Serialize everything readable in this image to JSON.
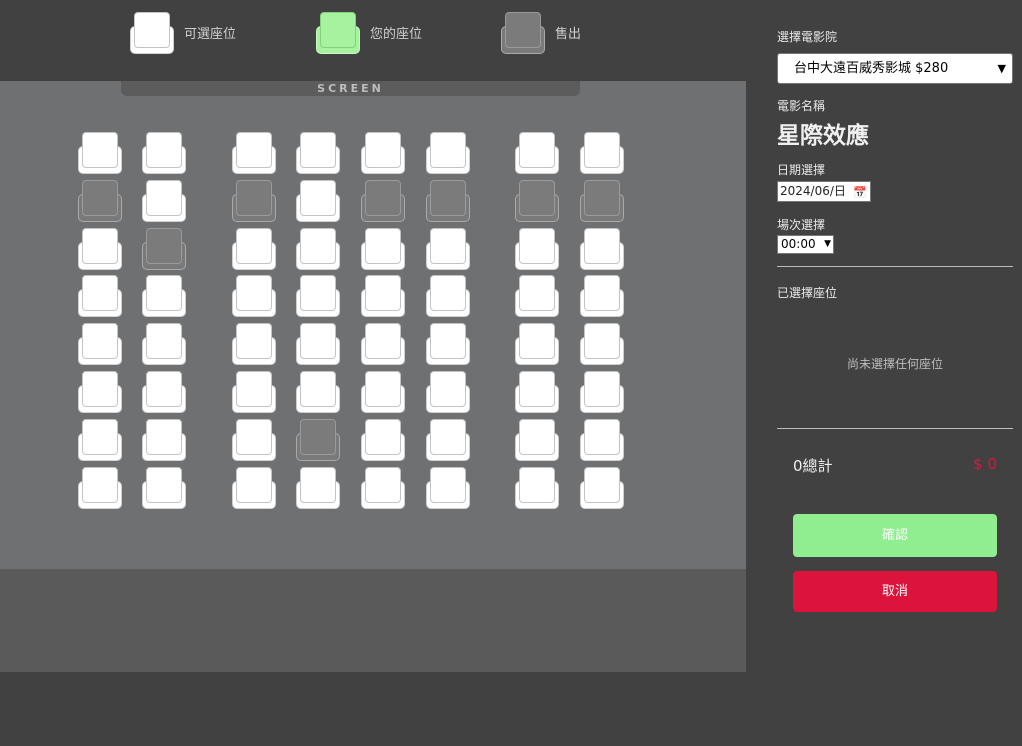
{
  "legend": {
    "available_label": "可選座位",
    "mine_label": "您的座位",
    "sold_label": "售出"
  },
  "screen_label": "SCREEN",
  "seats": [
    [
      "available",
      "available",
      "available",
      "available",
      "available",
      "available",
      "available",
      "available"
    ],
    [
      "sold",
      "available",
      "sold",
      "available",
      "sold",
      "sold",
      "sold",
      "sold"
    ],
    [
      "available",
      "sold",
      "available",
      "available",
      "available",
      "available",
      "available",
      "available"
    ],
    [
      "available",
      "available",
      "available",
      "available",
      "available",
      "available",
      "available",
      "available"
    ],
    [
      "available",
      "available",
      "available",
      "available",
      "available",
      "available",
      "available",
      "available"
    ],
    [
      "available",
      "available",
      "available",
      "available",
      "available",
      "available",
      "available",
      "available"
    ],
    [
      "available",
      "available",
      "available",
      "sold",
      "available",
      "available",
      "available",
      "available"
    ],
    [
      "available",
      "available",
      "available",
      "available",
      "available",
      "available",
      "available",
      "available"
    ]
  ],
  "panel": {
    "cinema_label": "選擇電影院",
    "cinema_value": "台中大遠百威秀影城 $280",
    "movie_label": "電影名稱",
    "movie_title": "星際效應",
    "date_label": "日期選擇",
    "date_value": "2024/06/日",
    "time_label": "場次選擇",
    "time_value": "00:00",
    "selected_label": "已選擇座位",
    "empty_message": "尚未選擇任何座位",
    "total_label": "0總計",
    "total_price": "$ 0",
    "confirm_label": "確認",
    "cancel_label": "取消"
  },
  "colors": {
    "available": "#ffffff",
    "mine": "#a6f29e",
    "sold": "#7a7a7a",
    "confirm": "#90ee90",
    "cancel": "#dc143c",
    "price": "#dc143c"
  }
}
